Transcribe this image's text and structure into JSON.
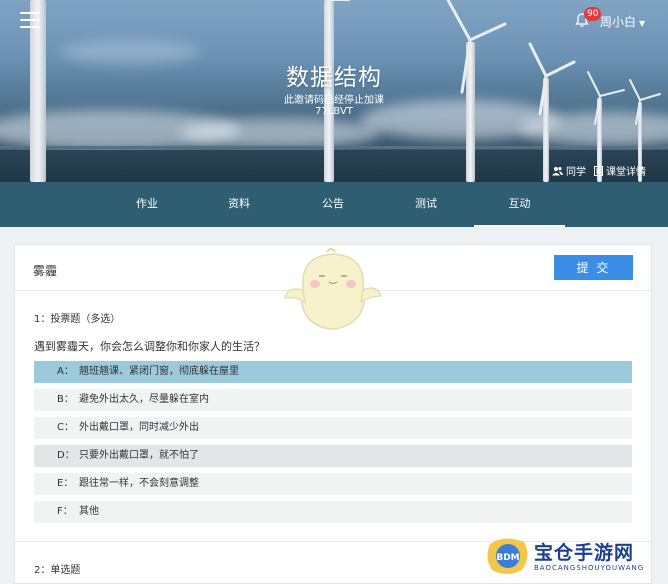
{
  "header": {
    "notification_count": "90",
    "username": "周小白",
    "course_title": "数据结构",
    "invite_status": "此邀请码已经停止加课",
    "invite_code": "77LBVT",
    "links": [
      {
        "label": "同学",
        "icon": "users-icon"
      },
      {
        "label": "课堂详情",
        "icon": "document-icon"
      }
    ]
  },
  "tabs": [
    {
      "label": "作业",
      "active": false
    },
    {
      "label": "资料",
      "active": false
    },
    {
      "label": "公告",
      "active": false
    },
    {
      "label": "测试",
      "active": false
    },
    {
      "label": "互动",
      "active": true
    }
  ],
  "card": {
    "title": "雾霾",
    "submit_label": "提 交",
    "question1": {
      "type": "1：投票题（多选）",
      "text": "遇到雾霾天，你会怎么调整你和你家人的生活？",
      "options": [
        {
          "key": "A：",
          "text": "翘班翘课、紧闭门窗，彻底躲在屋里",
          "state": "selected"
        },
        {
          "key": "B：",
          "text": "避免外出太久，尽量躲在室内",
          "state": "normal"
        },
        {
          "key": "C：",
          "text": "外出戴口罩，同时减少外出",
          "state": "normal"
        },
        {
          "key": "D：",
          "text": "只要外出戴口罩，就不怕了",
          "state": "hover"
        },
        {
          "key": "E：",
          "text": "跟往常一样，不会刻意调整",
          "state": "normal"
        },
        {
          "key": "F：",
          "text": "其他",
          "state": "normal"
        }
      ]
    },
    "question2": {
      "type": "2：单选题"
    }
  },
  "watermark": {
    "name": "宝仓手游网",
    "sub": "BAOCANGSHOUYOUWANG",
    "logo_text": "BDM"
  },
  "colors": {
    "tabbar": "#2f5e73",
    "submit": "#3a8ee6",
    "selected_option": "#9cc9dc",
    "badge": "#e4393c"
  }
}
